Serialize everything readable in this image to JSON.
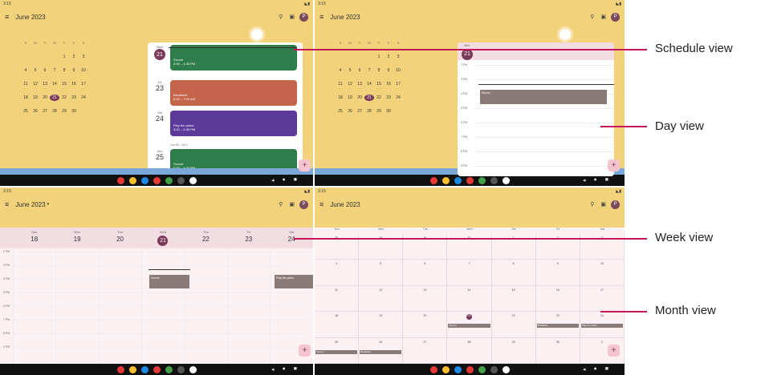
{
  "month_title": "June 2023",
  "colors": {
    "accent": "#7a3b5a",
    "leader": "#c2185b",
    "panel_bg": "#f2d27a"
  },
  "mini_month": {
    "weekdays": [
      "S",
      "M",
      "T",
      "W",
      "T",
      "F",
      "S"
    ],
    "cells": [
      "",
      "",
      "",
      "",
      "1",
      "2",
      "3",
      "4",
      "5",
      "6",
      "7",
      "8",
      "9",
      "10",
      "11",
      "12",
      "13",
      "14",
      "15",
      "16",
      "17",
      "18",
      "19",
      "20",
      "21",
      "22",
      "23",
      "24",
      "25",
      "26",
      "27",
      "28",
      "29",
      "30",
      ""
    ],
    "today": "21"
  },
  "schedule": {
    "rows": [
      {
        "dow": "Wed",
        "day": "21",
        "title": "Soccer",
        "time": "3:00 – 4:30 PM",
        "color": "#2e7d4a"
      },
      {
        "dow": "Fri",
        "day": "23",
        "title": "Breakfast",
        "time": "6:00 – 7:00 AM",
        "color": "#c4644a"
      },
      {
        "dow": "Sat",
        "day": "24",
        "title": "Play the piano",
        "time": "3:00 – 4:30 PM",
        "color": "#5b3a9a"
      },
      {
        "dow": "Sun",
        "day": "25",
        "title": "Soccer",
        "time": "3:00 – 4:30 PM",
        "color": "#2e7d4a"
      }
    ],
    "week_range": "Jun 25 – Jul 1"
  },
  "dayview": {
    "dow": "Wed",
    "day": "21",
    "hours": [
      "2 PM",
      "3 PM",
      "4 PM",
      "5 PM",
      "6 PM",
      "7 PM",
      "8 PM",
      "9 PM"
    ],
    "event": "Soccer"
  },
  "weekview": {
    "days": [
      {
        "dow": "Sun",
        "day": "18"
      },
      {
        "dow": "Mon",
        "day": "19"
      },
      {
        "dow": "Tue",
        "day": "20"
      },
      {
        "dow": "Wed",
        "day": "21"
      },
      {
        "dow": "Thu",
        "day": "22"
      },
      {
        "dow": "Fri",
        "day": "23"
      },
      {
        "dow": "Sat",
        "day": "24"
      }
    ],
    "hours": [
      "2 PM",
      "3 PM",
      "4 PM",
      "5 PM",
      "6 PM",
      "7 PM",
      "8 PM",
      "9 PM"
    ],
    "event_soccer": "Soccer",
    "event_piano": "Play the piano"
  },
  "monthview": {
    "weekdays": [
      "Sun",
      "Mon",
      "Tue",
      "Wed",
      "Thu",
      "Fri",
      "Sat"
    ],
    "cells": [
      "28",
      "29",
      "30",
      "31",
      "1",
      "2",
      "3",
      "4",
      "5",
      "6",
      "7",
      "8",
      "9",
      "10",
      "11",
      "12",
      "13",
      "14",
      "15",
      "16",
      "17",
      "18",
      "19",
      "20",
      "21",
      "22",
      "23",
      "24",
      "25",
      "26",
      "27",
      "28",
      "29",
      "30",
      "1"
    ],
    "events": {
      "21": "Soccer",
      "23": "Breakfast",
      "24": "Play the piano",
      "25a": "Soccer",
      "26": "Breakfast"
    }
  },
  "callouts": {
    "schedule": "Schedule view",
    "day": "Day view",
    "week": "Week view",
    "month": "Month view"
  },
  "status_time": "3:15"
}
